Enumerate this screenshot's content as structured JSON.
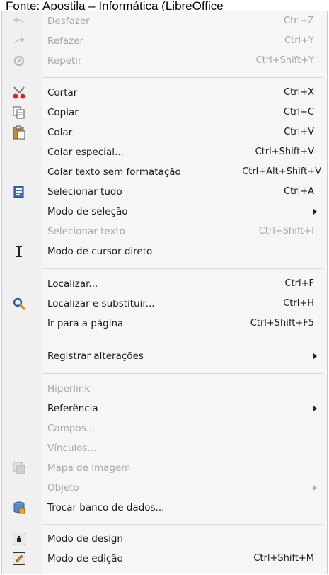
{
  "caption": "Fonte: Apostila – Informática (LibreOffice",
  "menu": {
    "items": [
      {
        "label": "Desfazer",
        "shortcut": "Ctrl+Z"
      },
      {
        "label": "Refazer",
        "shortcut": "Ctrl+Y"
      },
      {
        "label": "Repetir",
        "shortcut": "Ctrl+Shift+Y"
      },
      {
        "label": "Cortar",
        "shortcut": "Ctrl+X"
      },
      {
        "label": "Copiar",
        "shortcut": "Ctrl+C"
      },
      {
        "label": "Colar",
        "shortcut": "Ctrl+V"
      },
      {
        "label": "Colar especial...",
        "shortcut": "Ctrl+Shift+V"
      },
      {
        "label": "Colar texto sem formatação",
        "shortcut": "Ctrl+Alt+Shift+V"
      },
      {
        "label": "Selecionar tudo",
        "shortcut": "Ctrl+A"
      },
      {
        "label": "Modo de seleção",
        "shortcut": ""
      },
      {
        "label": "Selecionar texto",
        "shortcut": "Ctrl+Shift+I"
      },
      {
        "label": "Modo de cursor direto",
        "shortcut": ""
      },
      {
        "label": "Localizar...",
        "shortcut": "Ctrl+F"
      },
      {
        "label": "Localizar e substituir...",
        "shortcut": "Ctrl+H"
      },
      {
        "label": "Ir para a página",
        "shortcut": "Ctrl+Shift+F5"
      },
      {
        "label": "Registrar alterações",
        "shortcut": ""
      },
      {
        "label": "Hiperlink",
        "shortcut": ""
      },
      {
        "label": "Referência",
        "shortcut": ""
      },
      {
        "label": "Campos...",
        "shortcut": ""
      },
      {
        "label": "Vínculos...",
        "shortcut": ""
      },
      {
        "label": "Mapa de imagem",
        "shortcut": ""
      },
      {
        "label": "Objeto",
        "shortcut": ""
      },
      {
        "label": "Trocar banco de dados...",
        "shortcut": ""
      },
      {
        "label": "Modo de design",
        "shortcut": ""
      },
      {
        "label": "Modo de edição",
        "shortcut": "Ctrl+Shift+M"
      }
    ]
  }
}
